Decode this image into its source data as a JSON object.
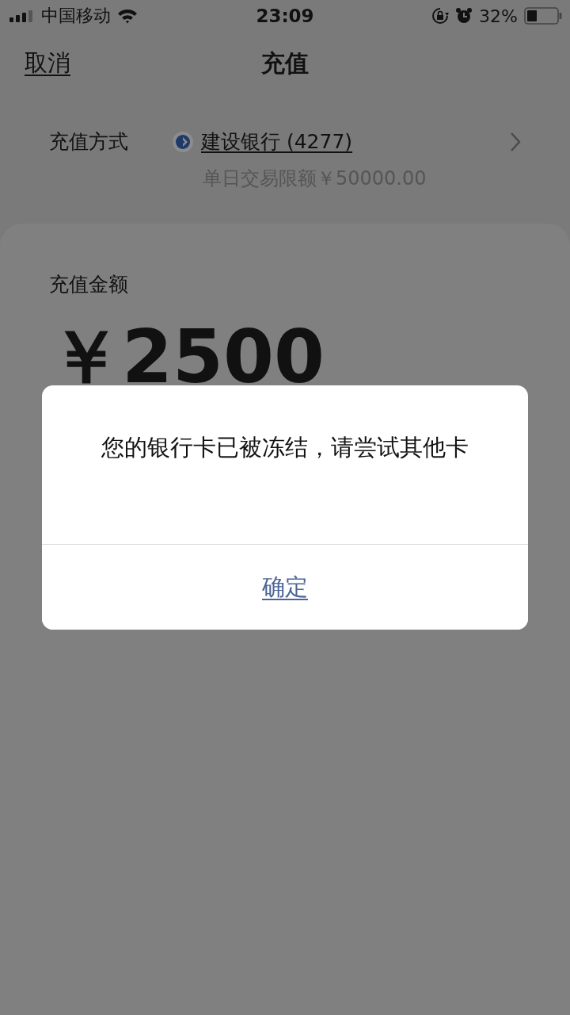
{
  "status_bar": {
    "carrier": "中国移动",
    "time": "23:09",
    "battery_percent": "32%"
  },
  "nav": {
    "cancel": "取消",
    "title": "充值"
  },
  "payment": {
    "label": "充值方式",
    "bank": "建设银行 (4277)",
    "limit": "单日交易限额￥50000.00"
  },
  "amount": {
    "label": "充值金额",
    "value": "￥2500"
  },
  "dialog": {
    "message": "您的银行卡已被冻结，请尝试其他卡",
    "button": "确定"
  }
}
